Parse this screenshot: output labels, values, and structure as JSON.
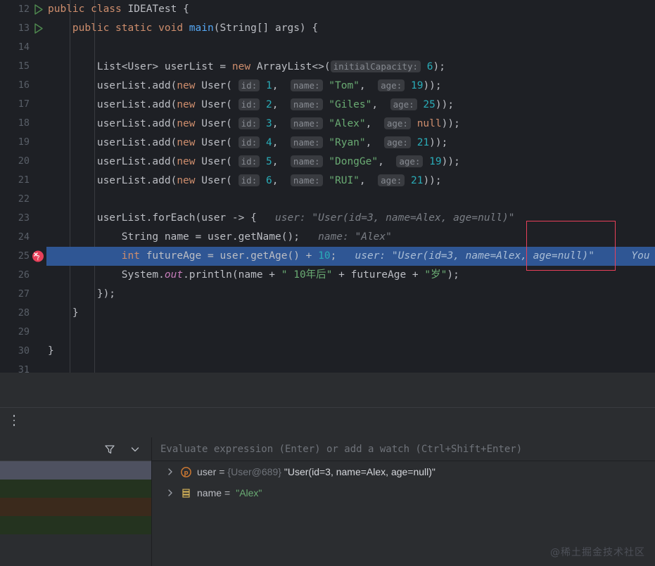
{
  "editor": {
    "first_line_number": 12,
    "background": "#1e2025",
    "selected_line_color": "#2f5694",
    "gutter_number_color": "#595f68",
    "lines": [
      {
        "n": 12,
        "gutter": "run-arrow",
        "indent": 0,
        "segments": [
          {
            "t": "public ",
            "c": "kw"
          },
          {
            "t": "class ",
            "c": "kw"
          },
          {
            "t": "IDEATest ",
            "c": "cls"
          },
          {
            "t": "{",
            "c": "punct"
          }
        ]
      },
      {
        "n": 13,
        "gutter": "run-arrow",
        "indent": 1,
        "segments": [
          {
            "t": "    ",
            "c": "punct"
          },
          {
            "t": "public ",
            "c": "kw"
          },
          {
            "t": "static ",
            "c": "kw"
          },
          {
            "t": "void ",
            "c": "kw"
          },
          {
            "t": "main",
            "c": "method"
          },
          {
            "t": "(String[] args) {",
            "c": "punct"
          }
        ]
      },
      {
        "n": 14,
        "gutter": "",
        "indent": 1,
        "segments": []
      },
      {
        "n": 15,
        "gutter": "",
        "indent": 2,
        "segments": [
          {
            "t": "        List<User> userList = ",
            "c": "ident"
          },
          {
            "t": "new ",
            "c": "kw"
          },
          {
            "t": "ArrayList<>(",
            "c": "ident"
          },
          {
            "t": "initialCapacity:",
            "c": "chip"
          },
          {
            "t": " ",
            "c": "ident"
          },
          {
            "t": "6",
            "c": "num"
          },
          {
            "t": ");",
            "c": "punct"
          }
        ]
      },
      {
        "n": 16,
        "gutter": "",
        "indent": 2,
        "segments": [
          {
            "t": "        userList.add(",
            "c": "ident"
          },
          {
            "t": "new ",
            "c": "kw"
          },
          {
            "t": "User(",
            "c": "ident"
          },
          {
            "t": " ",
            "c": "ident"
          },
          {
            "t": "id:",
            "c": "chip"
          },
          {
            "t": " ",
            "c": "ident"
          },
          {
            "t": "1",
            "c": "num"
          },
          {
            "t": ",  ",
            "c": "punct"
          },
          {
            "t": "name:",
            "c": "chip"
          },
          {
            "t": " ",
            "c": "ident"
          },
          {
            "t": "\"Tom\"",
            "c": "str"
          },
          {
            "t": ",  ",
            "c": "punct"
          },
          {
            "t": "age:",
            "c": "chip"
          },
          {
            "t": " ",
            "c": "ident"
          },
          {
            "t": "19",
            "c": "num"
          },
          {
            "t": "));",
            "c": "punct"
          }
        ]
      },
      {
        "n": 17,
        "gutter": "",
        "indent": 2,
        "segments": [
          {
            "t": "        userList.add(",
            "c": "ident"
          },
          {
            "t": "new ",
            "c": "kw"
          },
          {
            "t": "User(",
            "c": "ident"
          },
          {
            "t": " ",
            "c": "ident"
          },
          {
            "t": "id:",
            "c": "chip"
          },
          {
            "t": " ",
            "c": "ident"
          },
          {
            "t": "2",
            "c": "num"
          },
          {
            "t": ",  ",
            "c": "punct"
          },
          {
            "t": "name:",
            "c": "chip"
          },
          {
            "t": " ",
            "c": "ident"
          },
          {
            "t": "\"Giles\"",
            "c": "str"
          },
          {
            "t": ",  ",
            "c": "punct"
          },
          {
            "t": "age:",
            "c": "chip"
          },
          {
            "t": " ",
            "c": "ident"
          },
          {
            "t": "25",
            "c": "num"
          },
          {
            "t": "));",
            "c": "punct"
          }
        ]
      },
      {
        "n": 18,
        "gutter": "",
        "indent": 2,
        "segments": [
          {
            "t": "        userList.add(",
            "c": "ident"
          },
          {
            "t": "new ",
            "c": "kw"
          },
          {
            "t": "User(",
            "c": "ident"
          },
          {
            "t": " ",
            "c": "ident"
          },
          {
            "t": "id:",
            "c": "chip"
          },
          {
            "t": " ",
            "c": "ident"
          },
          {
            "t": "3",
            "c": "num"
          },
          {
            "t": ",  ",
            "c": "punct"
          },
          {
            "t": "name:",
            "c": "chip"
          },
          {
            "t": " ",
            "c": "ident"
          },
          {
            "t": "\"Alex\"",
            "c": "str"
          },
          {
            "t": ",  ",
            "c": "punct"
          },
          {
            "t": "age:",
            "c": "chip"
          },
          {
            "t": " ",
            "c": "ident"
          },
          {
            "t": "null",
            "c": "kw"
          },
          {
            "t": "));",
            "c": "punct"
          }
        ]
      },
      {
        "n": 19,
        "gutter": "",
        "indent": 2,
        "segments": [
          {
            "t": "        userList.add(",
            "c": "ident"
          },
          {
            "t": "new ",
            "c": "kw"
          },
          {
            "t": "User(",
            "c": "ident"
          },
          {
            "t": " ",
            "c": "ident"
          },
          {
            "t": "id:",
            "c": "chip"
          },
          {
            "t": " ",
            "c": "ident"
          },
          {
            "t": "4",
            "c": "num"
          },
          {
            "t": ",  ",
            "c": "punct"
          },
          {
            "t": "name:",
            "c": "chip"
          },
          {
            "t": " ",
            "c": "ident"
          },
          {
            "t": "\"Ryan\"",
            "c": "str"
          },
          {
            "t": ",  ",
            "c": "punct"
          },
          {
            "t": "age:",
            "c": "chip"
          },
          {
            "t": " ",
            "c": "ident"
          },
          {
            "t": "21",
            "c": "num"
          },
          {
            "t": "));",
            "c": "punct"
          }
        ]
      },
      {
        "n": 20,
        "gutter": "",
        "indent": 2,
        "segments": [
          {
            "t": "        userList.add(",
            "c": "ident"
          },
          {
            "t": "new ",
            "c": "kw"
          },
          {
            "t": "User(",
            "c": "ident"
          },
          {
            "t": " ",
            "c": "ident"
          },
          {
            "t": "id:",
            "c": "chip"
          },
          {
            "t": " ",
            "c": "ident"
          },
          {
            "t": "5",
            "c": "num"
          },
          {
            "t": ",  ",
            "c": "punct"
          },
          {
            "t": "name:",
            "c": "chip"
          },
          {
            "t": " ",
            "c": "ident"
          },
          {
            "t": "\"DongGe\"",
            "c": "str"
          },
          {
            "t": ",  ",
            "c": "punct"
          },
          {
            "t": "age:",
            "c": "chip"
          },
          {
            "t": " ",
            "c": "ident"
          },
          {
            "t": "19",
            "c": "num"
          },
          {
            "t": "));",
            "c": "punct"
          }
        ]
      },
      {
        "n": 21,
        "gutter": "",
        "indent": 2,
        "segments": [
          {
            "t": "        userList.add(",
            "c": "ident"
          },
          {
            "t": "new ",
            "c": "kw"
          },
          {
            "t": "User(",
            "c": "ident"
          },
          {
            "t": " ",
            "c": "ident"
          },
          {
            "t": "id:",
            "c": "chip"
          },
          {
            "t": " ",
            "c": "ident"
          },
          {
            "t": "6",
            "c": "num"
          },
          {
            "t": ",  ",
            "c": "punct"
          },
          {
            "t": "name:",
            "c": "chip"
          },
          {
            "t": " ",
            "c": "ident"
          },
          {
            "t": "\"RUI\"",
            "c": "str"
          },
          {
            "t": ",  ",
            "c": "punct"
          },
          {
            "t": "age:",
            "c": "chip"
          },
          {
            "t": " ",
            "c": "ident"
          },
          {
            "t": "21",
            "c": "num"
          },
          {
            "t": "));",
            "c": "punct"
          }
        ]
      },
      {
        "n": 22,
        "gutter": "",
        "indent": 2,
        "segments": []
      },
      {
        "n": 23,
        "gutter": "",
        "indent": 2,
        "segments": [
          {
            "t": "        userList.forEach(user -> {",
            "c": "ident"
          },
          {
            "t": "   user: \"User(id=3, name=Alex, age=null)\"",
            "c": "hintinl"
          }
        ]
      },
      {
        "n": 24,
        "gutter": "",
        "indent": 3,
        "segments": [
          {
            "t": "            String name = user.getName();",
            "c": "ident"
          },
          {
            "t": "   name: \"Alex\"",
            "c": "hintinl"
          }
        ]
      },
      {
        "n": 25,
        "gutter": "breakpoint",
        "selected": true,
        "indent": 3,
        "segments": [
          {
            "t": "            ",
            "c": "ident"
          },
          {
            "t": "int ",
            "c": "kw"
          },
          {
            "t": "futureAge = user.getAge() + ",
            "c": "ident"
          },
          {
            "t": "10",
            "c": "num"
          },
          {
            "t": ";",
            "c": "punct"
          },
          {
            "t": "   user: \"User(id=3, name=Alex, age=null)\"      You",
            "c": "hintinl-sel"
          }
        ]
      },
      {
        "n": 26,
        "gutter": "",
        "indent": 3,
        "segments": [
          {
            "t": "            System.",
            "c": "ident"
          },
          {
            "t": "out",
            "c": "field"
          },
          {
            "t": ".println(name + ",
            "c": "ident"
          },
          {
            "t": "\" 10年后\"",
            "c": "str"
          },
          {
            "t": " + futureAge + ",
            "c": "ident"
          },
          {
            "t": "\"岁\"",
            "c": "str"
          },
          {
            "t": ");",
            "c": "punct"
          }
        ]
      },
      {
        "n": 27,
        "gutter": "",
        "indent": 2,
        "segments": [
          {
            "t": "        });",
            "c": "punct"
          }
        ]
      },
      {
        "n": 28,
        "gutter": "",
        "indent": 1,
        "segments": [
          {
            "t": "    }",
            "c": "punct"
          }
        ]
      },
      {
        "n": 29,
        "gutter": "",
        "indent": 1,
        "segments": []
      },
      {
        "n": 30,
        "gutter": "",
        "indent": 0,
        "segments": [
          {
            "t": "}",
            "c": "punct"
          }
        ]
      },
      {
        "n": 31,
        "gutter": "",
        "indent": 0,
        "segments": []
      }
    ],
    "annotation": {
      "shape": "rectangle",
      "color": "#e8405a"
    }
  },
  "debugger": {
    "evaluate_placeholder": "Evaluate expression (Enter) or add a watch (Ctrl+Shift+Enter)",
    "frames_panel": {
      "filter_icon": "filter-icon",
      "chevron_icon": "chevron-down-icon",
      "rows": [
        {
          "color": "#4e5160"
        },
        {
          "color": "#24331f"
        },
        {
          "color": "#3b2a1c"
        },
        {
          "color": "#24331f"
        }
      ]
    },
    "variables": [
      {
        "twisty": "chevron-right-icon",
        "icon": "parameter-icon",
        "icon_kind": "parameter",
        "name": "user",
        "eq": "=",
        "ref": "{User@689}",
        "value": "\"User(id=3, name=Alex, age=null)\"",
        "value_kind": "plain"
      },
      {
        "twisty": "chevron-right-icon",
        "icon": "local-variable-icon",
        "icon_kind": "local",
        "name": "name",
        "eq": "=",
        "ref": "",
        "value": "\"Alex\"",
        "value_kind": "string"
      }
    ],
    "more_options_icon": "kebab-menu-icon"
  },
  "watermark": {
    "text": "@稀土掘金技术社区"
  }
}
